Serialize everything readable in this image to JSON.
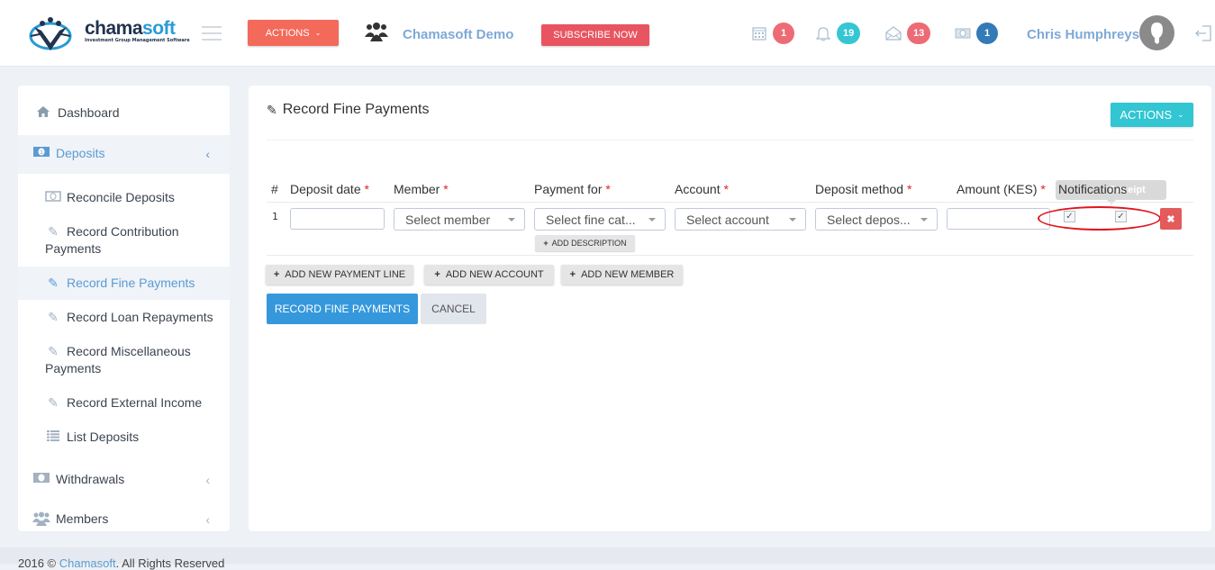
{
  "header": {
    "logo_text_main": "chama",
    "logo_text_accent": "soft",
    "logo_tagline": "Investment Group Management Software",
    "actions_label": "ACTIONS",
    "group_name": "Chamasoft Demo",
    "subscribe_label": "SUBSCRIBE NOW",
    "notifications": [
      {
        "icon": "calendar-icon",
        "count": "1",
        "color": "#ed6b75"
      },
      {
        "icon": "bell-icon",
        "count": "19",
        "color": "#36c6d3"
      },
      {
        "icon": "envelope-open-icon",
        "count": "13",
        "color": "#ed6b75"
      },
      {
        "icon": "money-icon",
        "count": "1",
        "color": "#337ab7"
      }
    ],
    "user_name": "Chris Humphreys"
  },
  "sidebar": {
    "items": [
      {
        "label": "Dashboard",
        "icon": "home-icon"
      },
      {
        "label": "Deposits",
        "icon": "money-icon",
        "active": true
      },
      {
        "label": "Withdrawals",
        "icon": "money-icon"
      },
      {
        "label": "Members",
        "icon": "users-icon"
      }
    ],
    "deposits_sub": [
      {
        "label": "Reconcile Deposits",
        "icon": "money-icon"
      },
      {
        "label": "Record Contribution Payments",
        "icon": "pencil-icon"
      },
      {
        "label": "Record Fine Payments",
        "icon": "pencil-icon",
        "active": true
      },
      {
        "label": "Record Loan Repayments",
        "icon": "pencil-icon"
      },
      {
        "label": "Record Miscellaneous Payments",
        "icon": "pencil-icon"
      },
      {
        "label": "Record External Income",
        "icon": "pencil-icon"
      },
      {
        "label": "List Deposits",
        "icon": "list-icon"
      }
    ]
  },
  "main": {
    "title": "Record Fine Payments",
    "actions_label": "ACTIONS",
    "table": {
      "headers": {
        "num": "#",
        "deposit_date": "Deposit date",
        "member": "Member",
        "payment_for": "Payment for",
        "account": "Account",
        "deposit_method": "Deposit method",
        "amount": "Amount (KES)",
        "notifications": "Notifications"
      },
      "required_mark": "*",
      "tooltip": "Receipt",
      "rows": [
        {
          "num": "1",
          "deposit_date": "",
          "member_placeholder": "Select member",
          "payment_for_placeholder": "Select fine cat...",
          "account_placeholder": "Select account",
          "deposit_method_placeholder": "Select depos...",
          "amount": "",
          "notify_sms": true,
          "notify_email": true,
          "add_description_label": "ADD DESCRIPTION"
        }
      ]
    },
    "buttons": {
      "add_line": "ADD NEW PAYMENT LINE",
      "add_account": "ADD NEW ACCOUNT",
      "add_member": "ADD NEW MEMBER",
      "submit": "RECORD FINE PAYMENTS",
      "cancel": "CANCEL"
    }
  },
  "footer": {
    "year": "2016 ©",
    "brand": "Chamasoft",
    "rights": "All Rights Reserved"
  }
}
